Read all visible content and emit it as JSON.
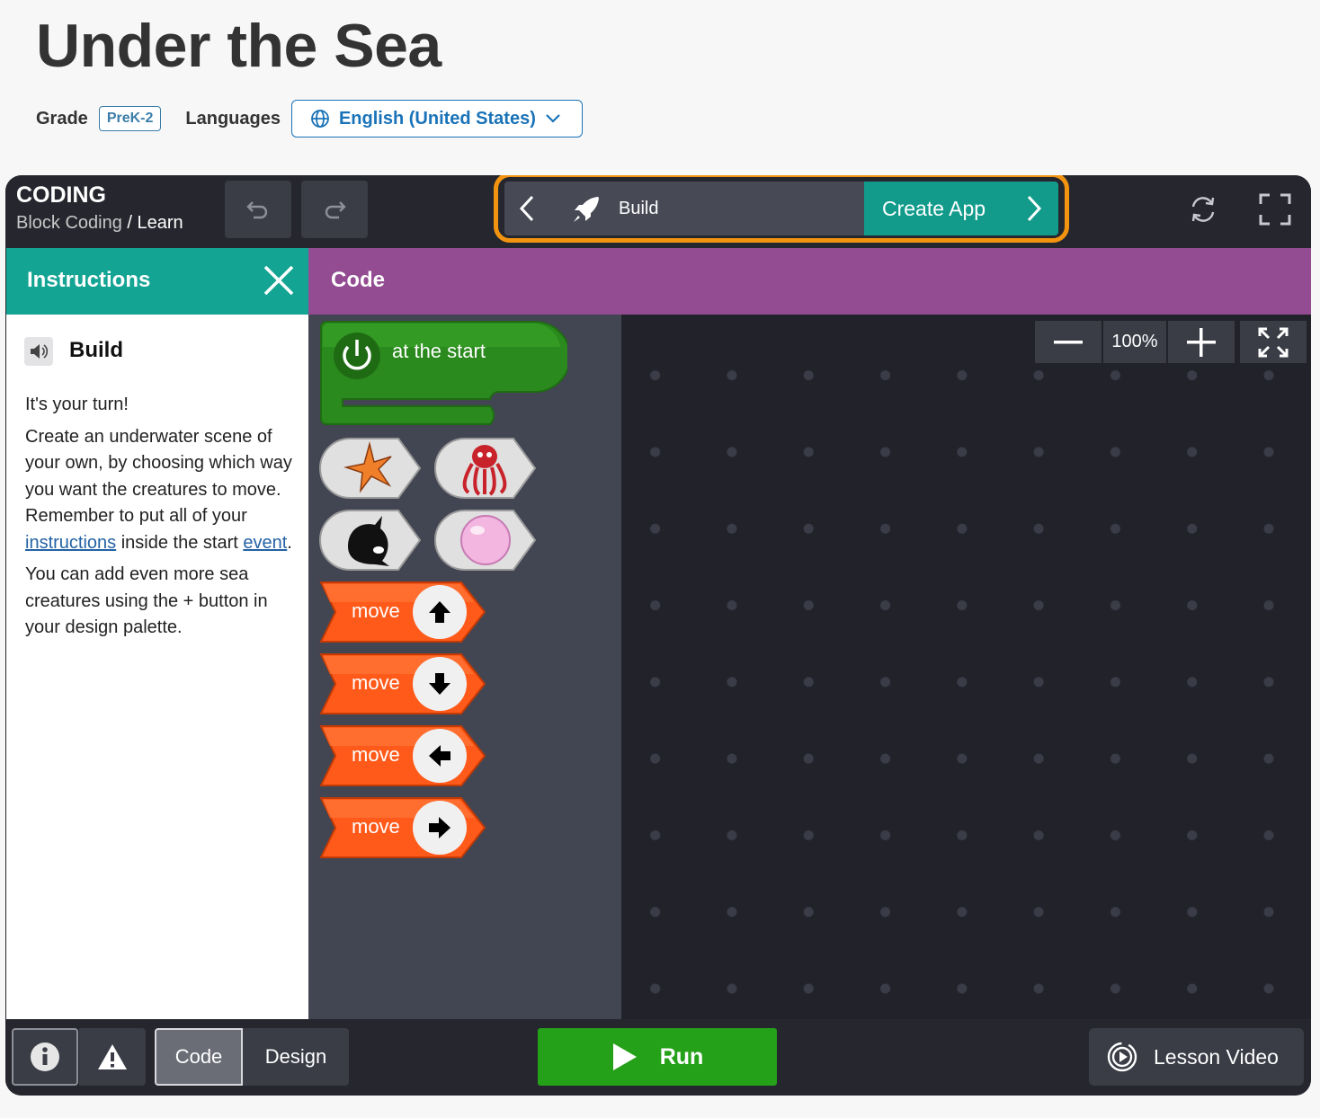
{
  "page": {
    "title": "Under the Sea",
    "grade_label": "Grade",
    "grade_value": "PreK-2",
    "languages_label": "Languages",
    "language_value": "English (United States)"
  },
  "topbar": {
    "brand_title": "CODING",
    "breadcrumb_course": "Block Coding",
    "breadcrumb_sep": " / ",
    "breadcrumb_page": "Learn",
    "undo_icon": "undo-icon",
    "redo_icon": "redo-icon",
    "current_step": "Build",
    "next_step": "Create App",
    "highlight_color": "#f39410"
  },
  "instructions": {
    "header": "Instructions",
    "title": "Build",
    "p1": "It's your turn!",
    "p2_a": "Create an underwater scene of your own, by choosing which way you want the creatures to move. Remember to put all of your ",
    "p2_link1": "instructions",
    "p2_b": " inside the start ",
    "p2_link2": "event",
    "p2_c": ".",
    "p3": "You can add even more sea creatures using the + button in your design palette."
  },
  "code": {
    "header": "Code",
    "zoom_level": "100%",
    "start_block": "at the start",
    "sprites": [
      "starfish",
      "octopus",
      "orca",
      "bubble"
    ],
    "move_blocks": [
      {
        "label": "move",
        "direction": "up"
      },
      {
        "label": "move",
        "direction": "down"
      },
      {
        "label": "move",
        "direction": "left"
      },
      {
        "label": "move",
        "direction": "right"
      }
    ]
  },
  "footer": {
    "info_icon": "info-icon",
    "warning_icon": "warning-icon",
    "tab_code": "Code",
    "tab_design": "Design",
    "run_label": "Run",
    "lesson_video_label": "Lesson Video"
  },
  "colors": {
    "teal": "#14a493",
    "purple": "#934c92",
    "run_green": "#24a019",
    "move_orange": "#ff5a1a",
    "event_green": "#2a8a1d"
  }
}
